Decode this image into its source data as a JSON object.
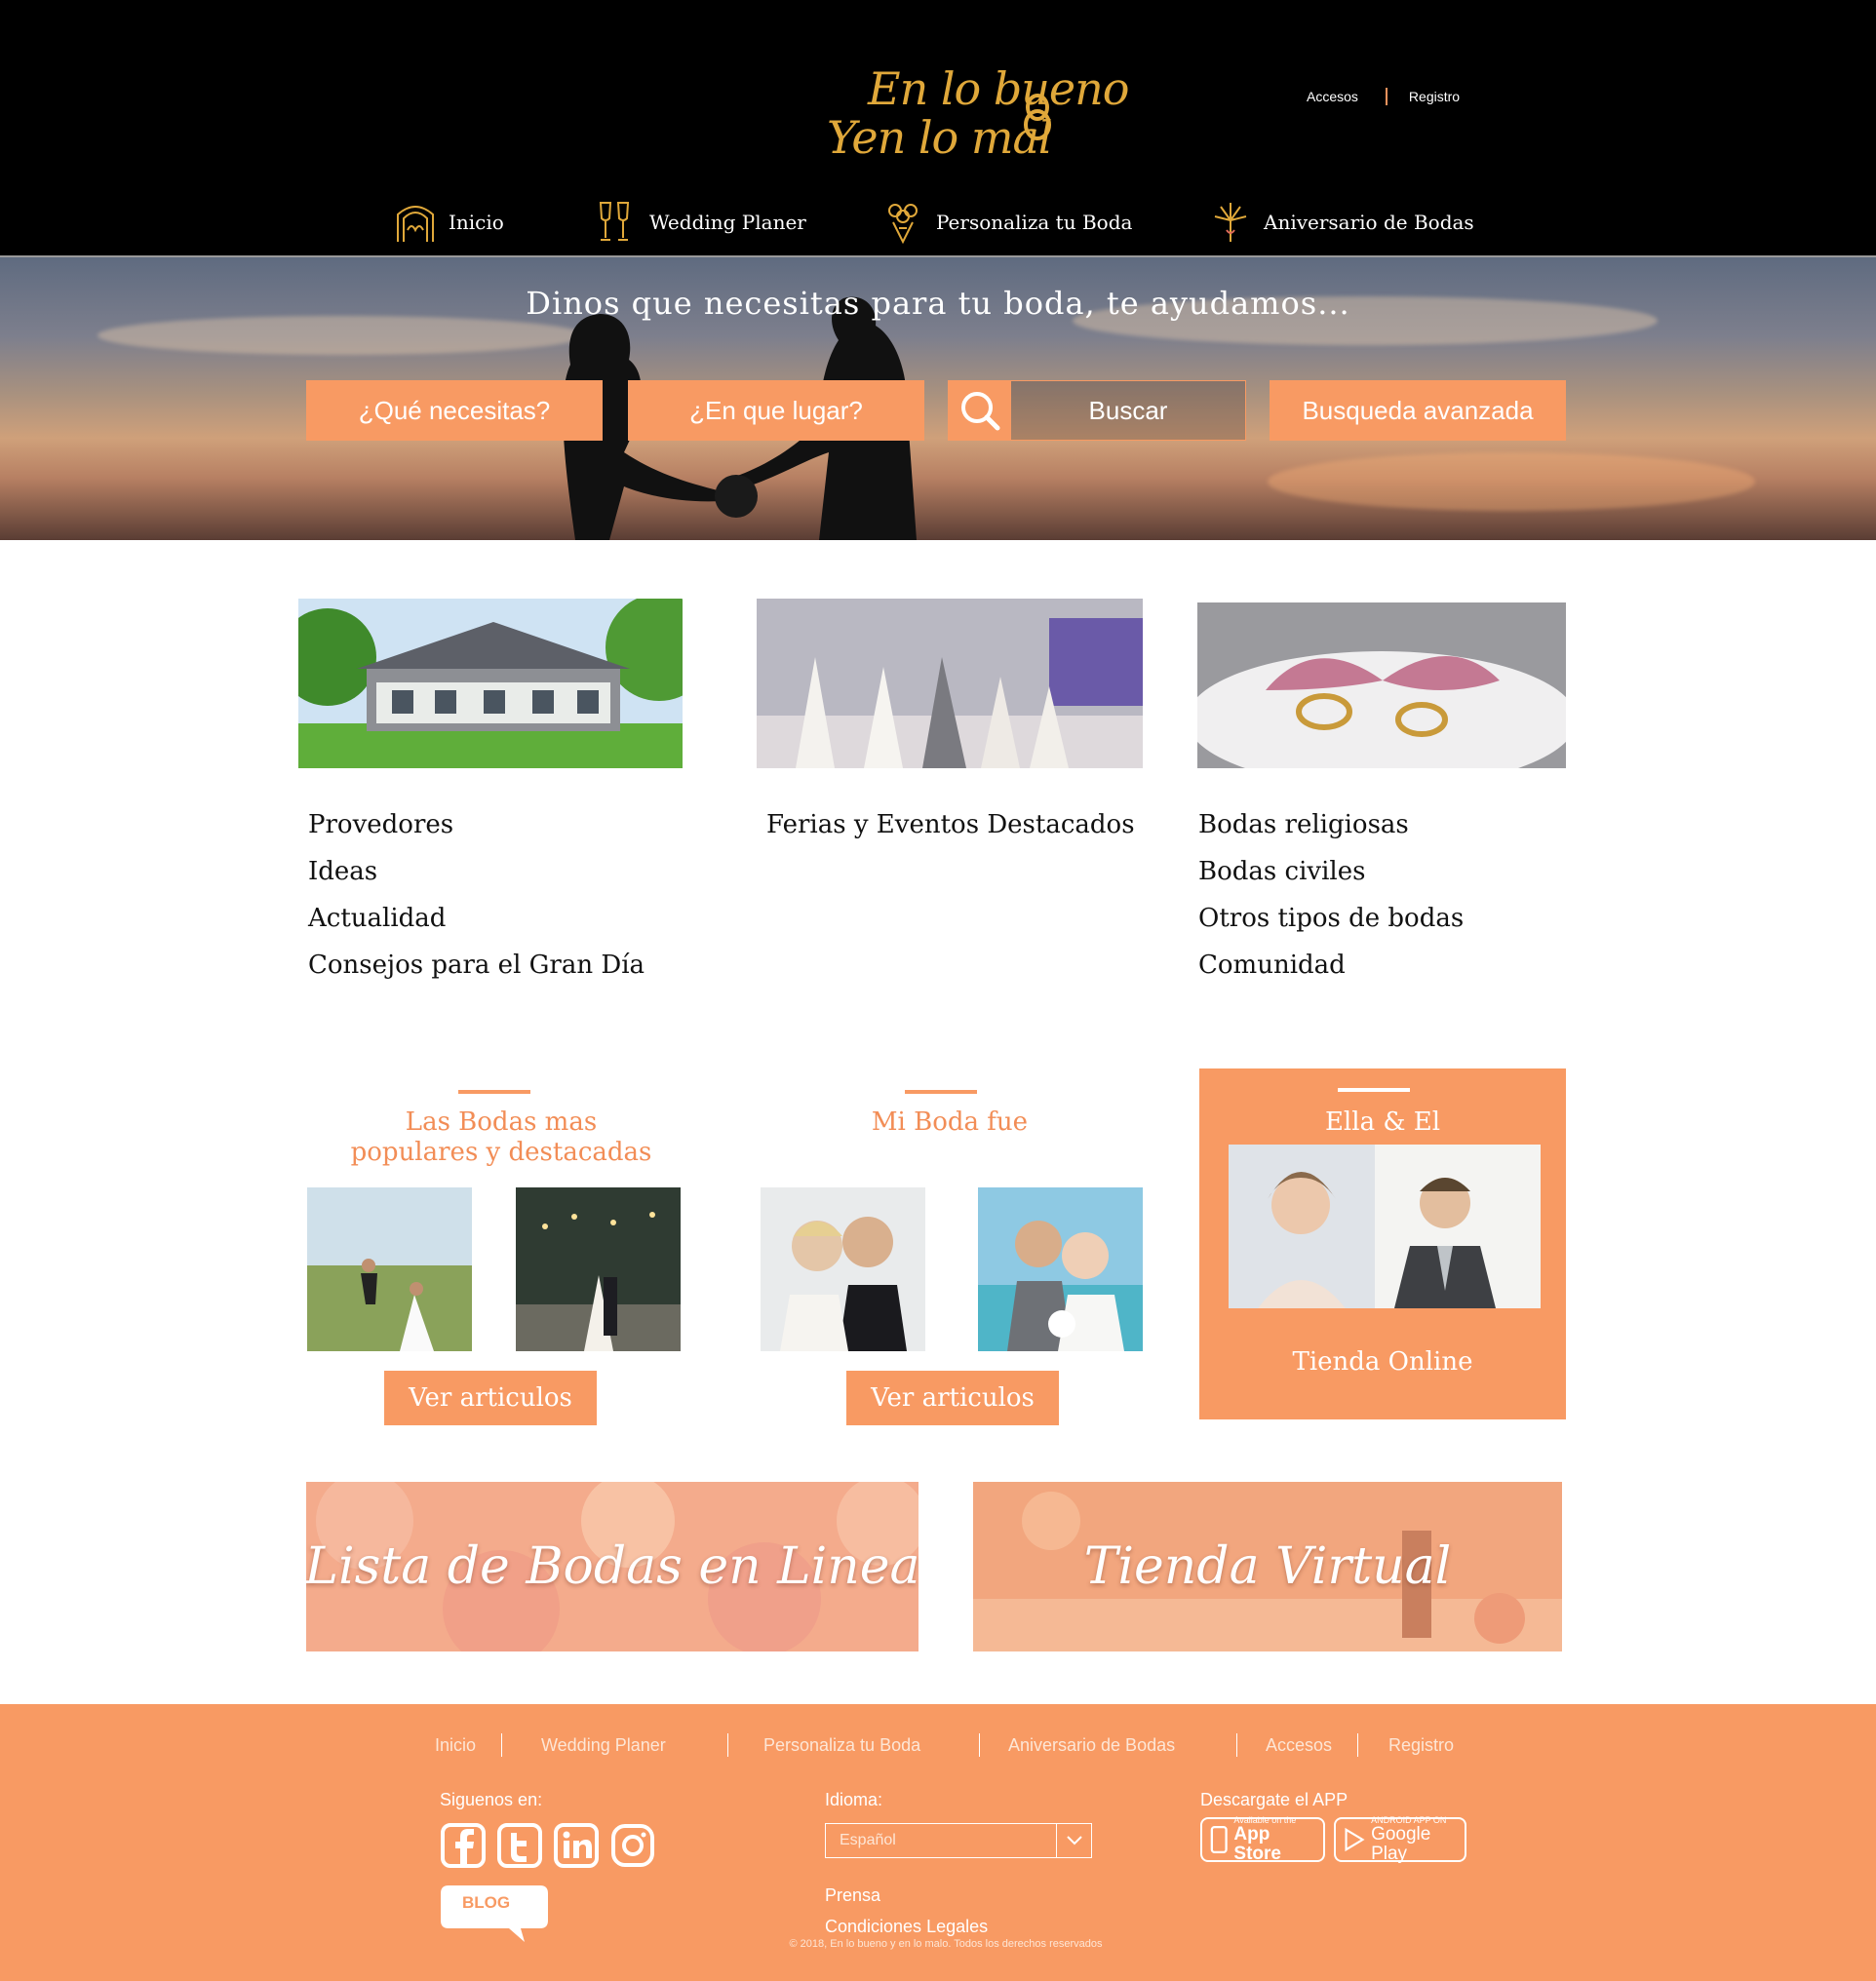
{
  "header": {
    "logo_line1": "En lo bueno",
    "logo_line2": "Yen lo mal",
    "top_links": {
      "access": "Accesos",
      "register": "Registro"
    },
    "nav": [
      {
        "label": "Inicio",
        "icon": "arch-icon"
      },
      {
        "label": "Wedding Planer",
        "icon": "champagne-glasses-icon"
      },
      {
        "label": "Personaliza tu Boda",
        "icon": "bouquet-icon"
      },
      {
        "label": "Aniversario de Bodas",
        "icon": "fireworks-icon"
      }
    ]
  },
  "hero": {
    "title": "Dinos que necesitas para tu boda, te ayudamos...",
    "what_button": "¿Qué necesitas?",
    "where_button": "¿En que lugar?",
    "search_button": "Buscar",
    "advanced_button": "Busqueda avanzada"
  },
  "categories": [
    {
      "image": "house-photo",
      "items": [
        "Provedores",
        "Ideas",
        "Actualidad",
        "Consejos para el Gran Día"
      ]
    },
    {
      "image": "wedding-fair-photo",
      "items": [
        "Ferias y Eventos Destacados"
      ]
    },
    {
      "image": "rings-photo",
      "items": [
        "Bodas religiosas",
        "Bodas civiles",
        "Otros tipos de bodas",
        "Comunidad"
      ]
    }
  ],
  "features": {
    "popular": {
      "title_line1": "Las Bodas mas",
      "title_line2": "populares y destacadas",
      "button": "Ver articulos"
    },
    "mi_boda": {
      "title": "Mi Boda fue",
      "button": "Ver articulos"
    },
    "ella_el": {
      "title": "Ella & El",
      "shop": "Tienda Online"
    }
  },
  "banners": {
    "registry": "Lista de Bodas en Linea",
    "shop": "Tienda Virtual"
  },
  "footer": {
    "nav": [
      "Inicio",
      "Wedding Planer",
      "Personaliza tu Boda",
      "Aniversario de Bodas",
      "Accesos",
      "Registro"
    ],
    "follow_label": "Siguenos en:",
    "social": [
      "facebook-icon",
      "twitter-icon",
      "linkedin-icon",
      "instagram-icon"
    ],
    "blog": "BLOG",
    "language_label": "Idioma:",
    "language_value": "Español",
    "press": "Prensa",
    "legal": "Condiciones Legales",
    "app_label": "Descargate el APP",
    "app_store_small": "Available on the",
    "app_store": "App Store",
    "google_small": "ANDROID APP ON",
    "google_play": "Google Play",
    "copyright": "© 2018, En lo bueno y en lo malo. Todos los derechos reservados"
  },
  "colors": {
    "accent": "#f89a63",
    "gold": "#e0a83a",
    "header_bg": "#000000"
  }
}
